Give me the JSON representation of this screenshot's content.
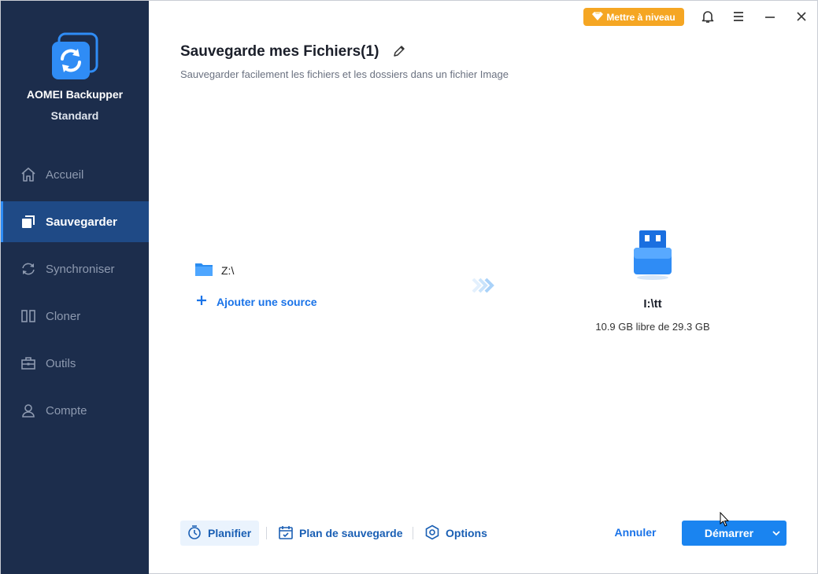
{
  "app": {
    "name": "AOMEI Backupper",
    "edition": "Standard"
  },
  "sidebar": {
    "items": [
      {
        "label": "Accueil",
        "icon": "home-icon",
        "active": false
      },
      {
        "label": "Sauvegarder",
        "icon": "backup-icon",
        "active": true
      },
      {
        "label": "Synchroniser",
        "icon": "sync-icon",
        "active": false
      },
      {
        "label": "Cloner",
        "icon": "clone-icon",
        "active": false
      },
      {
        "label": "Outils",
        "icon": "toolbox-icon",
        "active": false
      },
      {
        "label": "Compte",
        "icon": "user-icon",
        "active": false
      }
    ]
  },
  "topbar": {
    "upgrade_label": "Mettre à niveau"
  },
  "header": {
    "title": "Sauvegarde mes Fichiers(1)",
    "subtitle": "Sauvegarder facilement les fichiers et les dossiers dans un fichier Image"
  },
  "source": {
    "path": "Z:\\",
    "add_label": "Ajouter une source"
  },
  "destination": {
    "name": "I:\\tt",
    "space": "10.9 GB libre de 29.3 GB"
  },
  "footer": {
    "schedule_label": "Planifier",
    "plan_label": "Plan de sauvegarde",
    "options_label": "Options",
    "cancel_label": "Annuler",
    "start_label": "Démarrer"
  },
  "colors": {
    "sidebar_bg": "#1c2d4c",
    "sidebar_active": "#1f4a86",
    "accent": "#1a84f0",
    "upgrade": "#f5a623"
  }
}
